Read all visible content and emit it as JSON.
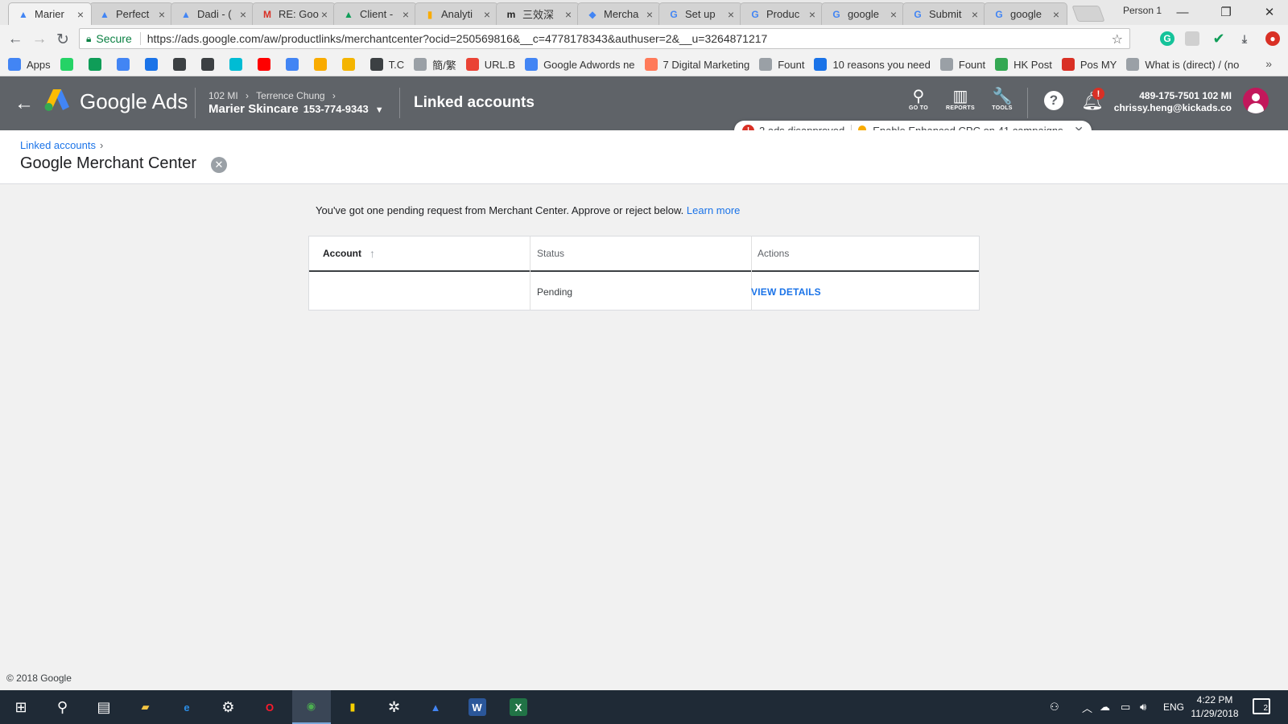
{
  "browser": {
    "tabs": [
      {
        "title": "Marier",
        "favicon": "google-ads-icon",
        "color": "#4285f4",
        "glyph": "▲",
        "active": true
      },
      {
        "title": "Perfect",
        "favicon": "google-ads-icon",
        "color": "#4285f4",
        "glyph": "▲"
      },
      {
        "title": "Dadi - (",
        "favicon": "google-ads-icon",
        "color": "#4285f4",
        "glyph": "▲"
      },
      {
        "title": "RE: Goo",
        "favicon": "gmail-icon",
        "color": "#d93025",
        "glyph": "M"
      },
      {
        "title": "Client -",
        "favicon": "google-drive-icon",
        "color": "#0f9d58",
        "glyph": "▲"
      },
      {
        "title": "Analyti",
        "favicon": "analytics-icon",
        "color": "#f9ab00",
        "glyph": "▮"
      },
      {
        "title": "三效深",
        "favicon": "medium-icon",
        "color": "#222222",
        "glyph": "m"
      },
      {
        "title": "Mercha",
        "favicon": "merchant-center-icon",
        "color": "#4285f4",
        "glyph": "◆"
      },
      {
        "title": "Set up",
        "favicon": "google-icon",
        "color": "#4285f4",
        "glyph": "G"
      },
      {
        "title": "Produc",
        "favicon": "google-icon",
        "color": "#4285f4",
        "glyph": "G"
      },
      {
        "title": "google",
        "favicon": "google-icon",
        "color": "#4285f4",
        "glyph": "G"
      },
      {
        "title": "Submit",
        "favicon": "google-icon",
        "color": "#4285f4",
        "glyph": "G"
      },
      {
        "title": "google",
        "favicon": "google-icon",
        "color": "#4285f4",
        "glyph": "G"
      }
    ],
    "profile_label": "Person 1",
    "secure_label": "Secure",
    "url": "https://ads.google.com/aw/productlinks/merchantcenter?ocid=250569816&__c=4778178343&authuser=2&__u=3264871217",
    "bookmarks": [
      {
        "label": "Apps",
        "icon": "apps-grid-icon",
        "color": "#4285f4"
      },
      {
        "label": "",
        "icon": "whatsapp-icon",
        "color": "#25d366"
      },
      {
        "label": "",
        "icon": "google-drive-icon",
        "color": "#0f9d58"
      },
      {
        "label": "",
        "icon": "google-ads-icon",
        "color": "#4285f4"
      },
      {
        "label": "",
        "icon": "share-icon",
        "color": "#1a73e8"
      },
      {
        "label": "",
        "icon": "save-icon",
        "color": "#3c4043"
      },
      {
        "label": "",
        "icon": "infinity-icon",
        "color": "#3c4043"
      },
      {
        "label": "",
        "icon": "c-icon",
        "color": "#00bcd4"
      },
      {
        "label": "",
        "icon": "youtube-icon",
        "color": "#ff0000"
      },
      {
        "label": "",
        "icon": "translate-icon",
        "color": "#4285f4"
      },
      {
        "label": "",
        "icon": "analytics-icon",
        "color": "#f9ab00"
      },
      {
        "label": "",
        "icon": "book-icon",
        "color": "#f4b400"
      },
      {
        "label": "T.C",
        "icon": "chevron-up-icon",
        "color": "#3c4043"
      },
      {
        "label": "簡/繁",
        "icon": "page-icon",
        "color": "#9aa0a6"
      },
      {
        "label": "URL.B",
        "icon": "circle-icon",
        "color": "#ea4335"
      },
      {
        "label": "Google Adwords ne",
        "icon": "google-icon",
        "color": "#4285f4"
      },
      {
        "label": "7 Digital Marketing",
        "icon": "hubspot-icon",
        "color": "#ff7a59"
      },
      {
        "label": "Fount",
        "icon": "page-icon",
        "color": "#9aa0a6"
      },
      {
        "label": "10 reasons you need",
        "icon": "drop-icon",
        "color": "#1a73e8"
      },
      {
        "label": "Fount",
        "icon": "page-icon",
        "color": "#9aa0a6"
      },
      {
        "label": "HK Post",
        "icon": "post-icon",
        "color": "#34a853"
      },
      {
        "label": "Pos MY",
        "icon": "pos-icon",
        "color": "#d93025"
      },
      {
        "label": "What is (direct) / (no",
        "icon": "page-icon",
        "color": "#9aa0a6"
      }
    ]
  },
  "ads": {
    "brand": "Google Ads",
    "crumb_manager": "102 MI",
    "crumb_client": "Terrence Chung",
    "account_name": "Marier Skincare",
    "account_id": "153-774-9343",
    "page_title": "Linked accounts",
    "tools": [
      {
        "label": "GO TO",
        "icon": "search-icon",
        "glyph": "⚲"
      },
      {
        "label": "REPORTS",
        "icon": "reports-icon",
        "glyph": "▥"
      },
      {
        "label": "TOOLS",
        "icon": "wrench-icon",
        "glyph": "🔧"
      }
    ],
    "help_glyph": "?",
    "bell_badge": "!",
    "user_line1": "489-175-7501 102 MI",
    "user_line2": "chrissy.heng@kickads.co",
    "notification": {
      "error_text": "2 ads disapproved",
      "tip_text": "Enable Enhanced CPC on 41 campaigns"
    },
    "breadcrumb_link": "Linked accounts",
    "heading": "Google Merchant Center",
    "pending_message": "You've got one pending request from Merchant Center. Approve or reject below.",
    "learn_more": "Learn more",
    "table": {
      "headers": [
        "Account",
        "Status",
        "Actions"
      ],
      "rows": [
        {
          "account": "",
          "status": "Pending",
          "action": "VIEW DETAILS"
        }
      ]
    },
    "copyright": "© 2018 Google"
  },
  "taskbar": {
    "apps": [
      {
        "icon": "windows-start-icon"
      },
      {
        "icon": "search-icon"
      },
      {
        "icon": "task-view-icon"
      },
      {
        "icon": "file-explorer-icon"
      },
      {
        "icon": "edge-icon"
      },
      {
        "icon": "settings-icon"
      },
      {
        "icon": "opera-icon"
      },
      {
        "icon": "chrome-icon"
      },
      {
        "icon": "sticky-notes-icon"
      },
      {
        "icon": "slack-icon"
      },
      {
        "icon": "google-ads-icon"
      },
      {
        "icon": "word-icon"
      },
      {
        "icon": "excel-icon"
      }
    ],
    "language": "ENG",
    "time": "4:22 PM",
    "date": "11/29/2018",
    "notification_count": "2"
  },
  "colors": {
    "ads_header": "#5f6368",
    "link_blue": "#1a73e8",
    "error_red": "#d93025",
    "tip_yellow": "#f9ab00",
    "taskbar": "#1f2a36"
  }
}
